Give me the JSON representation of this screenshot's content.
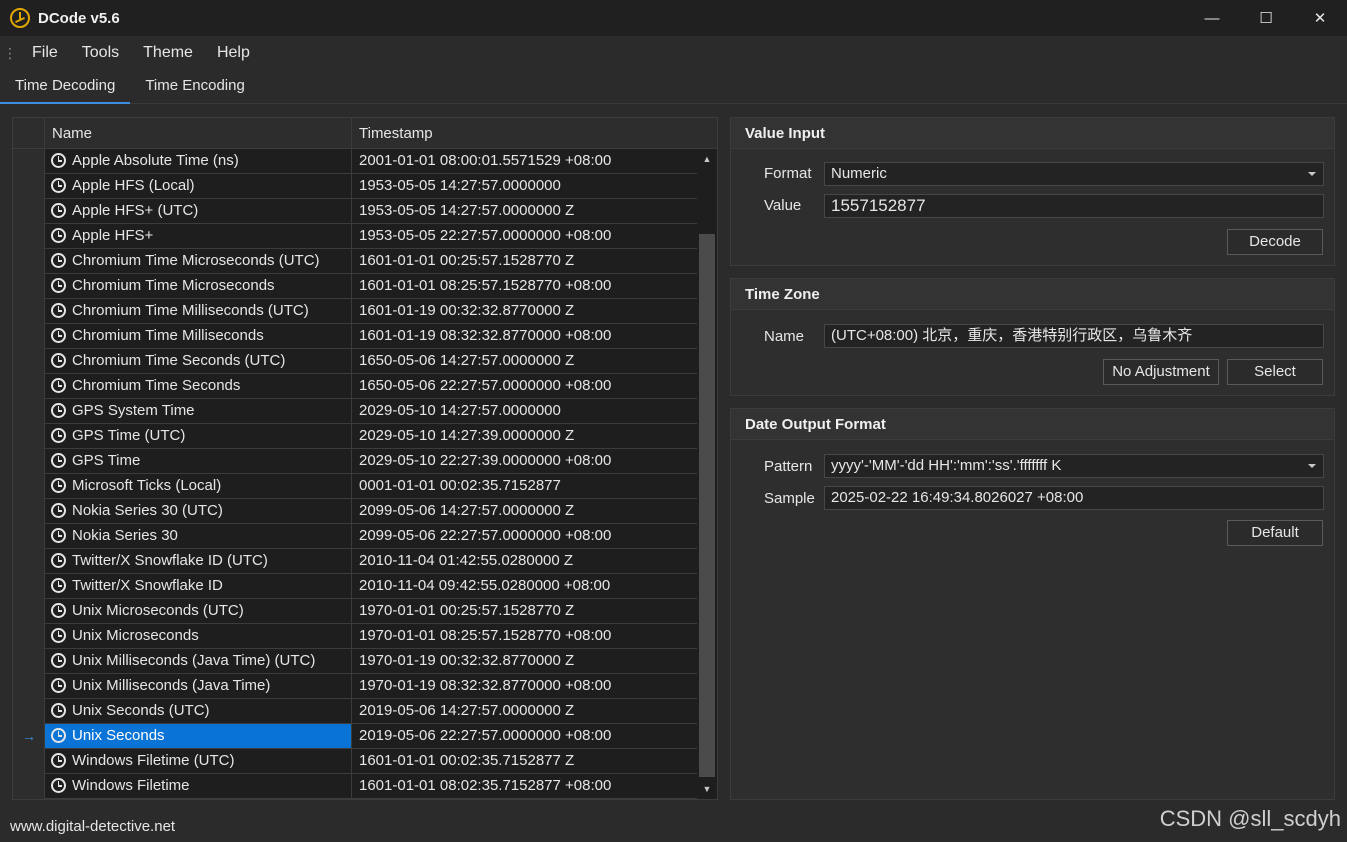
{
  "window": {
    "title": "DCode v5.6",
    "minimize": "—",
    "maximize": "☐",
    "close": "✕"
  },
  "menu": {
    "grip": "⋮",
    "items": [
      "File",
      "Tools",
      "Theme",
      "Help"
    ]
  },
  "tabs": [
    {
      "label": "Time Decoding",
      "active": true
    },
    {
      "label": "Time Encoding",
      "active": false
    }
  ],
  "grid": {
    "columns": [
      "Name",
      "Timestamp"
    ],
    "selected_index": 23,
    "row_marker": "→",
    "scroll_up": "▲",
    "scroll_down": "▼",
    "rows": [
      {
        "name": "Apple Absolute Time (ns)",
        "timestamp": "2001-01-01 08:00:01.5571529 +08:00"
      },
      {
        "name": "Apple HFS (Local)",
        "timestamp": "1953-05-05 14:27:57.0000000"
      },
      {
        "name": "Apple HFS+ (UTC)",
        "timestamp": "1953-05-05 14:27:57.0000000 Z"
      },
      {
        "name": "Apple HFS+",
        "timestamp": "1953-05-05 22:27:57.0000000 +08:00"
      },
      {
        "name": "Chromium Time Microseconds (UTC)",
        "timestamp": "1601-01-01 00:25:57.1528770 Z"
      },
      {
        "name": "Chromium Time Microseconds",
        "timestamp": "1601-01-01 08:25:57.1528770 +08:00"
      },
      {
        "name": "Chromium Time Milliseconds (UTC)",
        "timestamp": "1601-01-19 00:32:32.8770000 Z"
      },
      {
        "name": "Chromium Time Milliseconds",
        "timestamp": "1601-01-19 08:32:32.8770000 +08:00"
      },
      {
        "name": "Chromium Time Seconds (UTC)",
        "timestamp": "1650-05-06 14:27:57.0000000 Z"
      },
      {
        "name": "Chromium Time Seconds",
        "timestamp": "1650-05-06 22:27:57.0000000 +08:00"
      },
      {
        "name": "GPS System Time",
        "timestamp": "2029-05-10 14:27:57.0000000"
      },
      {
        "name": "GPS Time (UTC)",
        "timestamp": "2029-05-10 14:27:39.0000000 Z"
      },
      {
        "name": "GPS Time",
        "timestamp": "2029-05-10 22:27:39.0000000 +08:00"
      },
      {
        "name": "Microsoft Ticks (Local)",
        "timestamp": "0001-01-01 00:02:35.7152877"
      },
      {
        "name": "Nokia Series 30 (UTC)",
        "timestamp": "2099-05-06 14:27:57.0000000 Z"
      },
      {
        "name": "Nokia Series 30",
        "timestamp": "2099-05-06 22:27:57.0000000 +08:00"
      },
      {
        "name": "Twitter/X Snowflake ID (UTC)",
        "timestamp": "2010-11-04 01:42:55.0280000 Z"
      },
      {
        "name": "Twitter/X Snowflake ID",
        "timestamp": "2010-11-04 09:42:55.0280000 +08:00"
      },
      {
        "name": "Unix Microseconds (UTC)",
        "timestamp": "1970-01-01 00:25:57.1528770 Z"
      },
      {
        "name": "Unix Microseconds",
        "timestamp": "1970-01-01 08:25:57.1528770 +08:00"
      },
      {
        "name": "Unix Milliseconds (Java Time) (UTC)",
        "timestamp": "1970-01-19 00:32:32.8770000 Z"
      },
      {
        "name": "Unix Milliseconds (Java Time)",
        "timestamp": "1970-01-19 08:32:32.8770000 +08:00"
      },
      {
        "name": "Unix Seconds (UTC)",
        "timestamp": "2019-05-06 14:27:57.0000000 Z"
      },
      {
        "name": "Unix Seconds",
        "timestamp": "2019-05-06 22:27:57.0000000 +08:00"
      },
      {
        "name": "Windows Filetime (UTC)",
        "timestamp": "1601-01-01 00:02:35.7152877 Z"
      },
      {
        "name": "Windows Filetime",
        "timestamp": "1601-01-01 08:02:35.7152877 +08:00"
      }
    ]
  },
  "value_input": {
    "title": "Value Input",
    "format_label": "Format",
    "format_value": "Numeric",
    "value_label": "Value",
    "value": "1557152877",
    "decode_button": "Decode"
  },
  "time_zone": {
    "title": "Time Zone",
    "name_label": "Name",
    "name_value": "(UTC+08:00) 北京，重庆，香港特别行政区，乌鲁木齐",
    "no_adjustment_button": "No Adjustment",
    "select_button": "Select"
  },
  "date_output": {
    "title": "Date Output Format",
    "pattern_label": "Pattern",
    "pattern_value": "yyyy'-'MM'-'dd HH':'mm':'ss'.'fffffff K",
    "sample_label": "Sample",
    "sample_value": "2025-02-22 16:49:34.8026027 +08:00",
    "default_button": "Default"
  },
  "status": {
    "website": "www.digital-detective.net"
  },
  "watermark": "CSDN @sll_scdyh",
  "colors": {
    "accent": "#0a74d6",
    "background": "#2b2b2b",
    "grid_background": "#1e1e1e",
    "logo": "#e0a800"
  }
}
